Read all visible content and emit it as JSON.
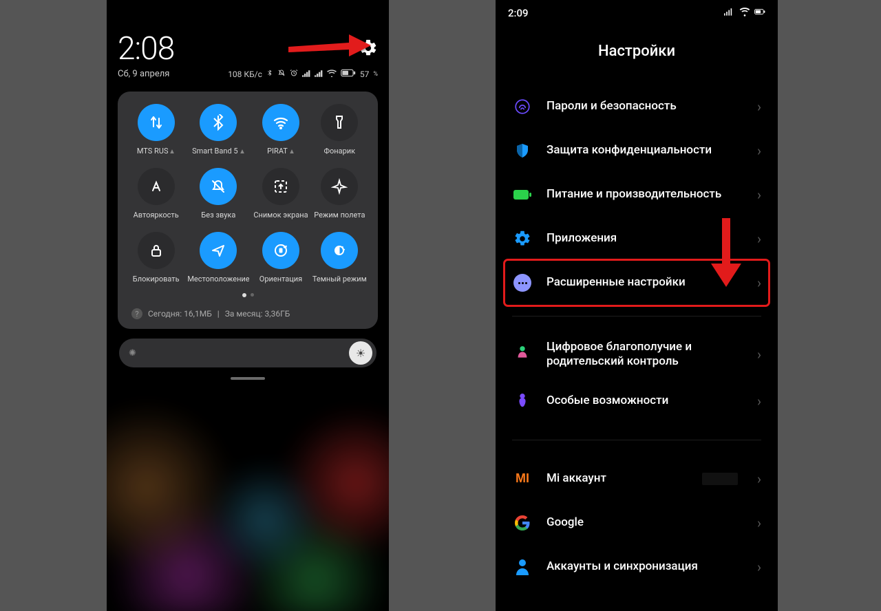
{
  "left": {
    "clock": "2:08",
    "date": "Сб, 9 апреля",
    "data_rate": "108 КБ/с",
    "battery_pct": "57",
    "battery_sfx": "%",
    "tiles": [
      {
        "label": "MTS RUS",
        "icon": "data-arrows",
        "on": true,
        "chev": true
      },
      {
        "label": "Smart Band 5",
        "icon": "bluetooth",
        "on": true,
        "chev": true
      },
      {
        "label": "PIRAT",
        "icon": "wifi",
        "on": true,
        "chev": true
      },
      {
        "label": "Фонарик",
        "icon": "flashlight",
        "on": false
      },
      {
        "label": "Автояркость",
        "icon": "autoA",
        "on": false
      },
      {
        "label": "Без звука",
        "icon": "mute-bell",
        "on": true
      },
      {
        "label": "Снимок экрана",
        "icon": "screenshot",
        "on": false
      },
      {
        "label": "Режим полета",
        "icon": "airplane",
        "on": false
      },
      {
        "label": "Блокировать",
        "icon": "lock",
        "on": false
      },
      {
        "label": "Местоположение",
        "icon": "location",
        "on": true
      },
      {
        "label": "Ориентация",
        "icon": "rotation",
        "on": true
      },
      {
        "label": "Темный режим",
        "icon": "darkmode",
        "on": true
      }
    ],
    "usage_today_label": "Сегодня: 16,1МБ",
    "usage_div": "|",
    "usage_month_label": "За месяц: 3,36ГБ"
  },
  "right": {
    "status_time": "2:09",
    "title": "Настройки",
    "items1": [
      {
        "label": "Пароли и безопасность",
        "icon": "fingerprint",
        "color": "#6a4bff"
      },
      {
        "label": "Защита конфиденциальности",
        "icon": "shield",
        "color": "#1a9bff"
      },
      {
        "label": "Питание и производительность",
        "icon": "battery",
        "color": "#2bd24b"
      },
      {
        "label": "Приложения",
        "icon": "apps-gear",
        "color": "#1a9bff"
      },
      {
        "label": "Расширенные настройки",
        "icon": "dots",
        "color": "#8d95ff",
        "highlight": true
      }
    ],
    "items2": [
      {
        "label": "Цифровое благополучие и родительский контроль",
        "icon": "wellbeing",
        "color": "#2bd27a"
      },
      {
        "label": "Особые возможности",
        "icon": "accessibility",
        "color": "#7a4bff"
      }
    ],
    "items3": [
      {
        "label": "Mi аккаунт",
        "icon": "mi",
        "color": "#ff7a1a",
        "masked": true
      },
      {
        "label": "Google",
        "icon": "google",
        "color": ""
      },
      {
        "label": "Аккаунты и синхронизация",
        "icon": "person-sync",
        "color": "#1a9bff"
      }
    ]
  }
}
